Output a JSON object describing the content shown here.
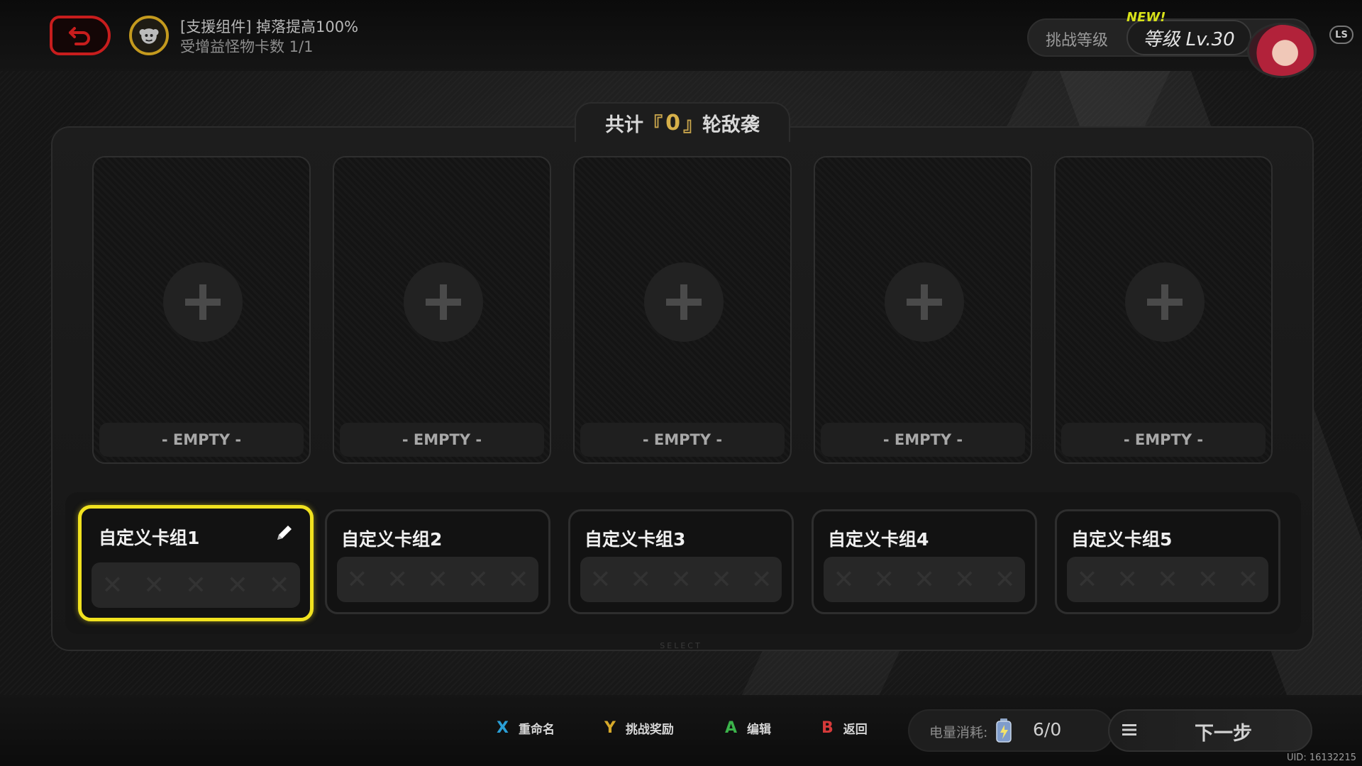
{
  "header": {
    "buff_line1": "[支援组件] 掉落提高100%",
    "buff_line2": "受增益怪物卡数 1/1",
    "challenge_label": "挑战等级",
    "level_text": "等级 Lv.30",
    "new_badge": "NEW!",
    "ls_label": "LS"
  },
  "panel": {
    "title_prefix": "共计",
    "bracket_open": "『",
    "wave_count": "0",
    "bracket_close": "』",
    "title_suffix": "轮敌袭"
  },
  "card_slots": [
    {
      "label": "- EMPTY -"
    },
    {
      "label": "- EMPTY -"
    },
    {
      "label": "- EMPTY -"
    },
    {
      "label": "- EMPTY -"
    },
    {
      "label": "- EMPTY -"
    }
  ],
  "decks": [
    {
      "name": "自定义卡组1",
      "selected": true
    },
    {
      "name": "自定义卡组2",
      "selected": false
    },
    {
      "name": "自定义卡组3",
      "selected": false
    },
    {
      "name": "自定义卡组4",
      "selected": false
    },
    {
      "name": "自定义卡组5",
      "selected": false
    }
  ],
  "select_hint": "SELECT",
  "footer": {
    "hints": [
      {
        "key": "X",
        "label": "重命名",
        "color": "#2a9fd6"
      },
      {
        "key": "Y",
        "label": "挑战奖励",
        "color": "#d6a92a"
      },
      {
        "key": "A",
        "label": "编辑",
        "color": "#3bb34a"
      },
      {
        "key": "B",
        "label": "返回",
        "color": "#d63a3a"
      }
    ],
    "energy_label": "电量消耗:",
    "energy_value": "6/0",
    "next_label": "下一步"
  },
  "uid": "UID: 16132215",
  "colors": {
    "accent_yellow": "#f1e21f",
    "back_red": "#c81d1d",
    "buff_gold": "#c49a1e"
  },
  "icons": {
    "back": "undo-arrow-icon",
    "buff": "monkey-emblem-icon",
    "edit": "pencil-icon",
    "add": "plus-icon",
    "battery": "battery-icon",
    "menu": "menu-icon"
  }
}
